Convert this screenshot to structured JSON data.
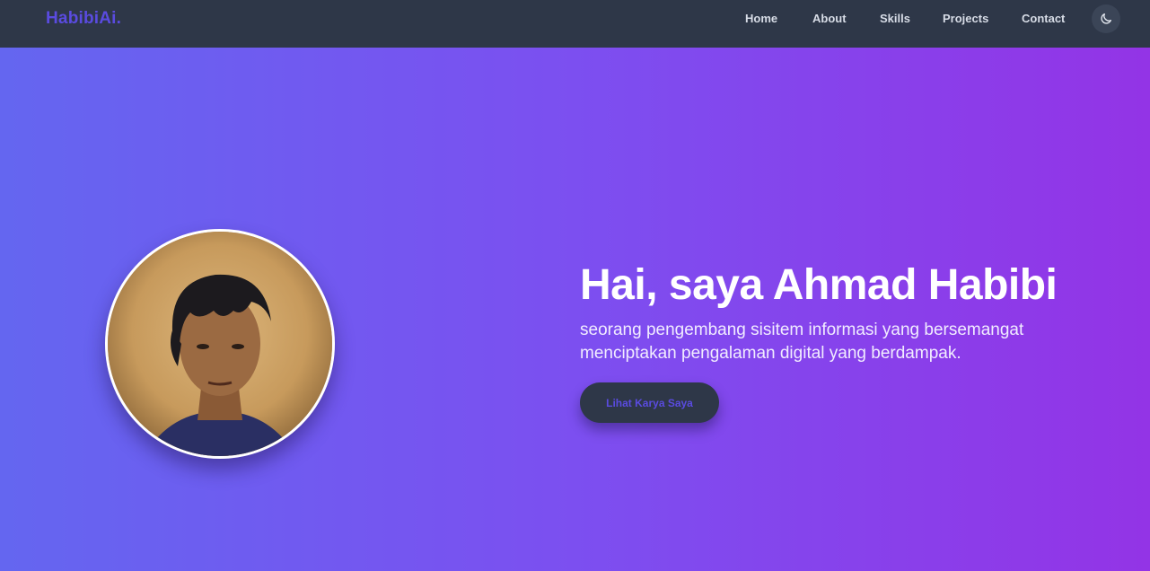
{
  "navbar": {
    "brand": "HabibiAi.",
    "links": [
      "Home",
      "About",
      "Skills",
      "Projects",
      "Contact"
    ],
    "theme_toggle_icon": "moon-icon"
  },
  "hero": {
    "title": "Hai, saya Ahmad Habibi",
    "subtitle": "seorang pengembang sisitem informasi yang bersemangat menciptakan pengalaman digital yang berdampak.",
    "cta_label": "Lihat Karya Saya",
    "avatar": "profile-photo"
  },
  "colors": {
    "navbar_bg": "#2e3748",
    "brand": "#5a4be0",
    "gradient_start": "#6466f0",
    "gradient_end": "#9334e6"
  }
}
